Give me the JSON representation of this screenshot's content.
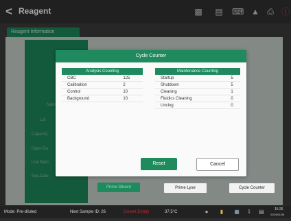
{
  "header": {
    "back_glyph": "<",
    "title": "Reagent",
    "icons": [
      "reagent-bottle-icon",
      "document-icon",
      "keyboard-icon",
      "tube-icon",
      "printer-icon",
      "alert-icon"
    ]
  },
  "tabs": {
    "reagent_information": "Reagent Information"
  },
  "fields": [
    "Name",
    "Lot",
    "Capacity",
    "Open Da",
    "Use Befo",
    "Exp.Date"
  ],
  "actions": {
    "prime_diluent": "Prime Diluent",
    "prime_lyse": "Prime Lyse",
    "cycle_counter": "Cycle Counter"
  },
  "dialog": {
    "title": "Cycle Counter",
    "analysis": {
      "header": "Analysis Counting",
      "rows": [
        {
          "label": "CBC",
          "value": "125"
        },
        {
          "label": "Calibration",
          "value": "2"
        },
        {
          "label": "Control",
          "value": "10"
        },
        {
          "label": "Background",
          "value": "10"
        }
      ]
    },
    "maintenance": {
      "header": "Maintenance Counting",
      "rows": [
        {
          "label": "Startup",
          "value": "5"
        },
        {
          "label": "Shutdown",
          "value": "5"
        },
        {
          "label": "Cleaning",
          "value": "1"
        },
        {
          "label": "Fluidics Cleaning",
          "value": "0"
        },
        {
          "label": "Unclog",
          "value": "0"
        }
      ]
    },
    "reset_label": "Reset",
    "cancel_label": "Cancel"
  },
  "status": {
    "mode": "Mode: Pre-diluted",
    "next_sample": "Next Sample ID: 26",
    "diluent_alarm": "Diluent Empty",
    "temperature": "37.5°C",
    "time": "15:26",
    "date": "2024/01/08",
    "icons": [
      "user-icon",
      "analyzer-icon",
      "storage-icon",
      "download-icon",
      "network-icon"
    ],
    "colors": {
      "alarm": "#c0282d",
      "accent": "#1e8a5d"
    }
  }
}
